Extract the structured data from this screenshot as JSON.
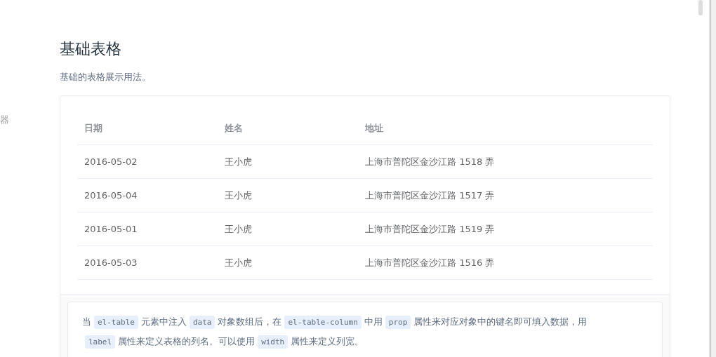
{
  "side_fragment": "器",
  "section": {
    "title": "基础表格",
    "description": "基础的表格展示用法。"
  },
  "table": {
    "columns": [
      "日期",
      "姓名",
      "地址"
    ],
    "rows": [
      [
        "2016-05-02",
        "王小虎",
        "上海市普陀区金沙江路 1518 弄"
      ],
      [
        "2016-05-04",
        "王小虎",
        "上海市普陀区金沙江路 1517 弄"
      ],
      [
        "2016-05-01",
        "王小虎",
        "上海市普陀区金沙江路 1519 弄"
      ],
      [
        "2016-05-03",
        "王小虎",
        "上海市普陀区金沙江路 1516 弄"
      ]
    ]
  },
  "explanation": [
    {
      "kind": "text",
      "text": "当"
    },
    {
      "kind": "code",
      "text": "el-table"
    },
    {
      "kind": "text",
      "text": "元素中注入"
    },
    {
      "kind": "code",
      "text": "data"
    },
    {
      "kind": "text",
      "text": "对象数组后，在"
    },
    {
      "kind": "code",
      "text": "el-table-column"
    },
    {
      "kind": "text",
      "text": "中用"
    },
    {
      "kind": "code",
      "text": "prop"
    },
    {
      "kind": "text",
      "text": "属性来对应对象中的键名即可填入数据，用"
    },
    {
      "kind": "code",
      "text": "label"
    },
    {
      "kind": "text",
      "text": "属性来定义表格的列名。可以使用"
    },
    {
      "kind": "code",
      "text": "width"
    },
    {
      "kind": "text",
      "text": "属性来定义列宽。"
    }
  ]
}
